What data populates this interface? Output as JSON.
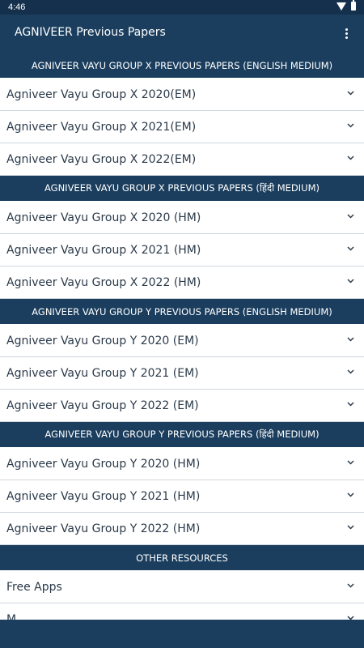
{
  "status_bar": {
    "time": "4:46",
    "icons": [
      "wifi-icon",
      "battery-icon"
    ]
  },
  "app_bar": {
    "title": "AGNIVEER Previous Papers",
    "menu_icon": "more-vert-icon"
  },
  "sections": [
    {
      "header": "AGNIVEER VAYU GROUP X PREVIOUS PAPERS (ENGLISH MEDIUM)",
      "items": [
        "Agniveer Vayu Group X 2020(EM)",
        "Agniveer Vayu Group X 2021(EM)",
        "Agniveer Vayu Group X 2022(EM)"
      ]
    },
    {
      "header": "AGNIVEER VAYU GROUP X PREVIOUS PAPERS (हिंदी MEDIUM)",
      "items": [
        "Agniveer Vayu Group X 2020 (HM)",
        "Agniveer Vayu Group X 2021 (HM)",
        "Agniveer Vayu Group X 2022 (HM)"
      ]
    },
    {
      "header": "AGNIVEER VAYU GROUP Y PREVIOUS PAPERS (ENGLISH MEDIUM)",
      "items": [
        "Agniveer Vayu Group Y 2020 (EM)",
        "Agniveer Vayu Group Y 2021 (EM)",
        "Agniveer Vayu Group Y 2022 (EM)"
      ]
    },
    {
      "header": "AGNIVEER VAYU GROUP Y PREVIOUS PAPERS (हिंदी MEDIUM)",
      "items": [
        "Agniveer Vayu Group Y 2020 (HM)",
        "Agniveer Vayu Group Y 2021 (HM)",
        "Agniveer Vayu Group Y 2022 (HM)"
      ]
    },
    {
      "header": "OTHER RESOURCES",
      "items": [
        "Free Apps",
        "M..."
      ]
    }
  ],
  "colors": {
    "primary": "#1b3e5e",
    "status_bar": "#15304d",
    "text": "#2b3a4a",
    "divider": "#cfd6de"
  },
  "item_icon": "chevron-down-icon"
}
